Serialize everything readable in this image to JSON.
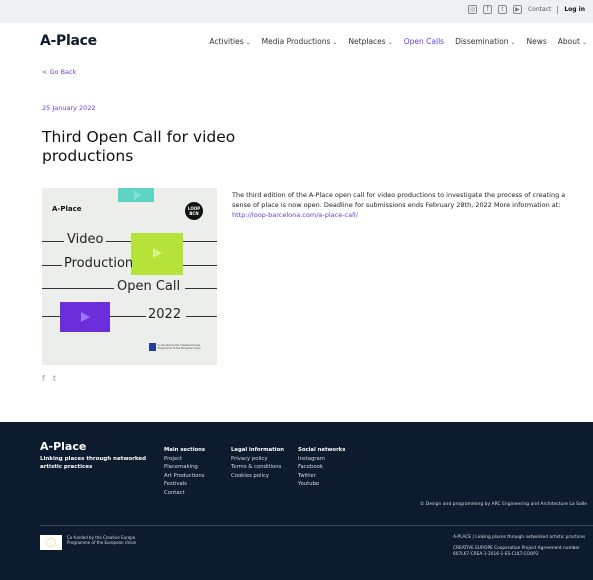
{
  "topbar": {
    "icons": [
      "instagram-icon",
      "facebook-icon",
      "twitter-icon",
      "youtube-icon"
    ],
    "icon_glyphs": [
      "◎",
      "f",
      "t",
      "▶"
    ],
    "contact": "Contact",
    "login": "Log in"
  },
  "nav": {
    "logo": "A-Place",
    "items": [
      {
        "label": "Activities",
        "dropdown": true
      },
      {
        "label": "Media Productions",
        "dropdown": true
      },
      {
        "label": "Netplaces",
        "dropdown": true
      },
      {
        "label": "Open Calls",
        "dropdown": false,
        "active": true
      },
      {
        "label": "Dissemination",
        "dropdown": true
      },
      {
        "label": "News",
        "dropdown": false
      },
      {
        "label": "About",
        "dropdown": true
      }
    ]
  },
  "article": {
    "go_back": "< Go Back",
    "date": "25 January 2022",
    "title": "Third Open Call for video productions",
    "body": "The third edition of the A-Place open call for video productions to investigate the process of creating a sense of place is now open. Deadline for submissions ends February 28th, 2022 More information at: ",
    "link": "http://loop-barcelona.com/a-place-call/"
  },
  "poster": {
    "logo": "A-Place",
    "loop": "LOOP BCN",
    "line1": "Video",
    "line2": "Production",
    "line3": "Open Call",
    "line4": "2022",
    "eu_text": "Co-funded by the Creative Europe Programme of the European Union",
    "colors": {
      "teal": "#5ed4c4",
      "green": "#b5e33a",
      "purple": "#6a2fdb"
    }
  },
  "share": {
    "facebook": "f",
    "twitter": "t"
  },
  "footer": {
    "logo": "A-Place",
    "tagline": "Linking places through networked artistic practices",
    "columns": [
      {
        "head": "Main sections",
        "items": [
          "Project",
          "Placemaking",
          "Art Productions",
          "Festivals",
          "Contact"
        ]
      },
      {
        "head": "Legal information",
        "items": [
          "Privacy policy",
          "Terms & conditions",
          "Cookies policy"
        ]
      },
      {
        "head": "Social networks",
        "items": [
          "Instagram",
          "Facebook",
          "Twitter",
          "Youtube"
        ]
      }
    ],
    "credit": "© Design and programming by ARC Engineering and Architecture La Salle",
    "cofund": "Co-funded by the Creative Europe Programme of the European Union",
    "right_info_1": "A-PLACE | Linking places through networked artistic practices",
    "right_info_2": "CREATIVE EUROPE Cooperation Project Agreement number 607L67-CREA-1-2016-1-ES-CULT-COOP2"
  },
  "colors": {
    "accent": "#6a3fd8",
    "footer_bg": "#0d1b2e",
    "topbar_bg": "#eef0f3"
  }
}
